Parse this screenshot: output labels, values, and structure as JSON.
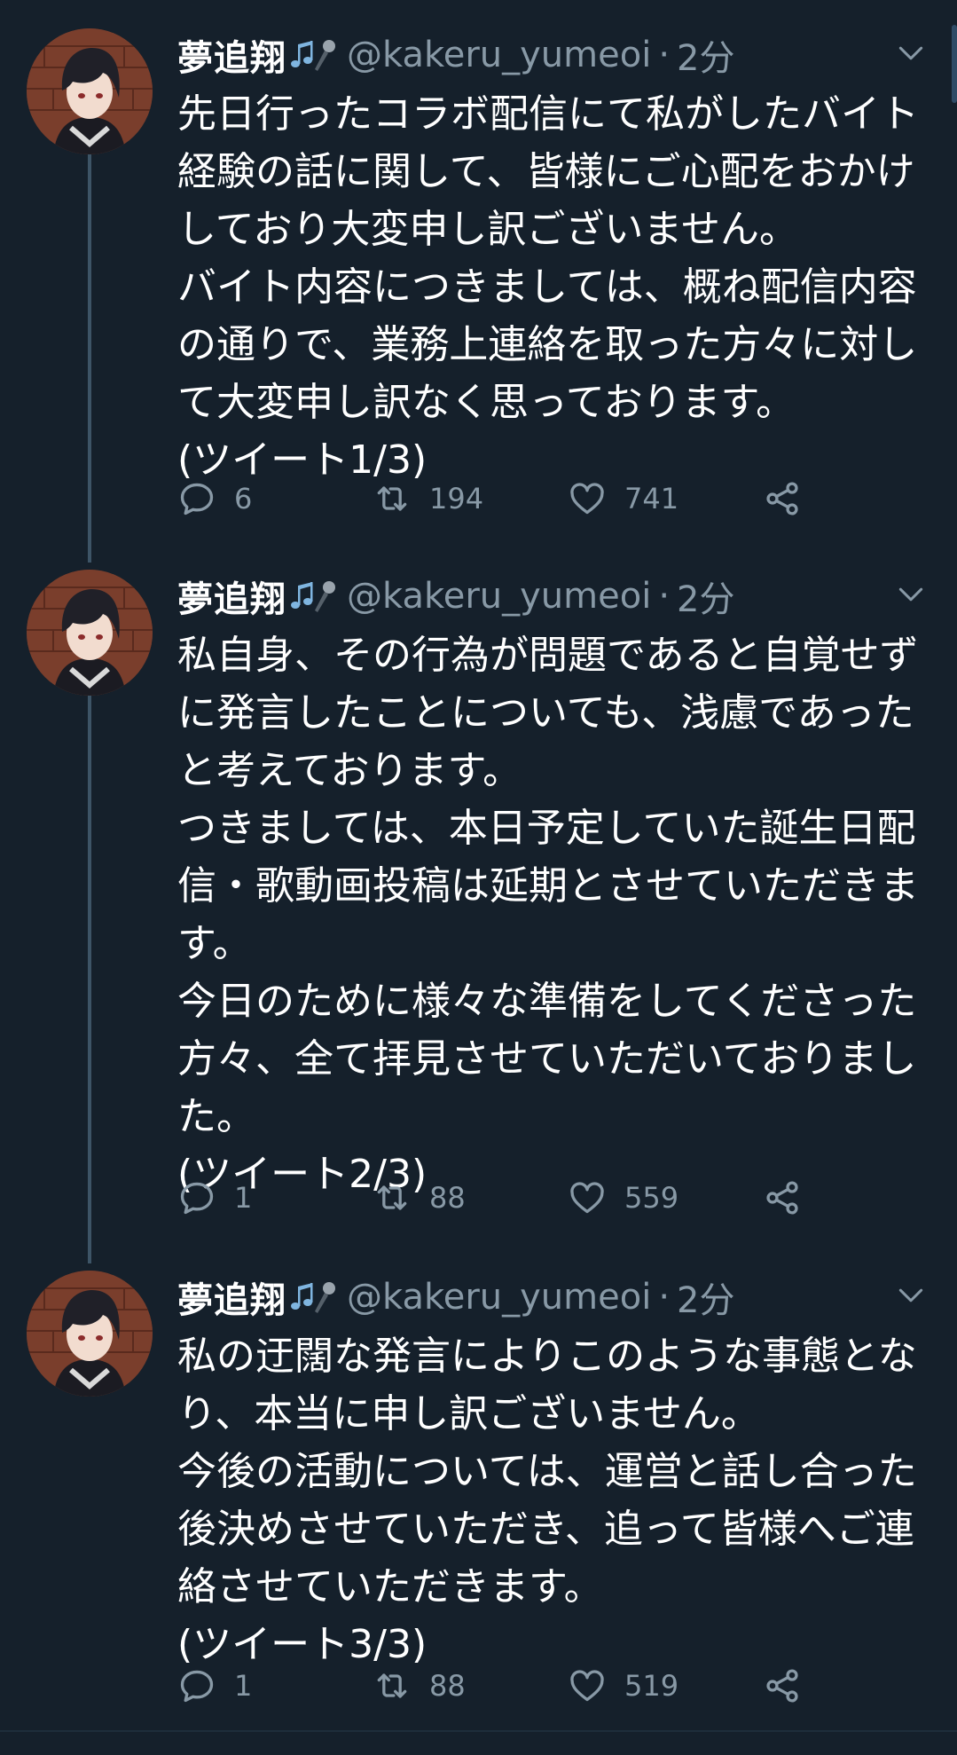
{
  "tweets": [
    {
      "name": "夢追翔",
      "handle": "@kakeru_yumeoi",
      "separator": "·",
      "time": "2分",
      "text": "先日行ったコラボ配信にて私がしたバイト経験の話に関して、皆様にご心配をおかけしており大変申し訳ございません。\nバイト内容につきましては、概ね配信内容の通りで、業務上連絡を取った方々に対して大変申し訳なく思っております。\n(ツイート1/3)",
      "replies": "6",
      "retweets": "194",
      "likes": "741"
    },
    {
      "name": "夢追翔",
      "handle": "@kakeru_yumeoi",
      "separator": "·",
      "time": "2分",
      "text": "私自身、その行為が問題であると自覚せずに発言したことについても、浅慮であったと考えております。\nつきましては、本日予定していた誕生日配信・歌動画投稿は延期とさせていただきます。\n今日のために様々な準備をしてくださった方々、全て拝見させていただいておりました。\n(ツイート2/3)",
      "replies": "1",
      "retweets": "88",
      "likes": "559"
    },
    {
      "name": "夢追翔",
      "handle": "@kakeru_yumeoi",
      "separator": "·",
      "time": "2分",
      "text": "私の迂闊な発言によりこのような事態となり、本当に申し訳ございません。\n今後の活動については、運営と話し合った後決めさせていただき、追って皆様へご連絡させていただきます。\n(ツイート3/3)",
      "replies": "1",
      "retweets": "88",
      "likes": "519"
    }
  ],
  "icons": {
    "name_emoji": "music-notes-microphone-icon",
    "caret": "chevron-down-icon",
    "reply": "reply-icon",
    "retweet": "retweet-icon",
    "like": "heart-icon",
    "share": "share-icon"
  },
  "colors": {
    "background": "#15202b",
    "text": "#ffffff",
    "secondary": "#8899a6",
    "thread_line": "#3d5466"
  }
}
